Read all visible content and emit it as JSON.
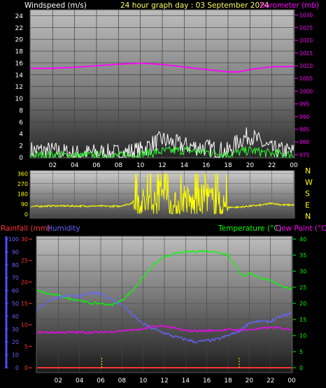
{
  "header": {
    "left_label": "Windspeed (m/s)",
    "title": "24 hour graph day : 03 September 2024",
    "right_label": "Barometer (mb)"
  },
  "colors": {
    "wind_axis": "#ffffff",
    "title": "#ffff66",
    "barometer": "#ff00ff",
    "wind_dir": "#ffff00",
    "rain_axis": "#ff3333",
    "humidity": "#6666ff",
    "temperature": "#00ff00",
    "dewpoint": "#ff00ff"
  },
  "panel3_labels": {
    "rainfall": "Rainfall (mm)",
    "humidity": "Humidity",
    "temperature": "Temperature (°C)",
    "dewpoint": "Dew Point (°C)"
  },
  "compass": [
    "N",
    "W",
    "S",
    "E",
    "N"
  ],
  "chart_data": [
    {
      "type": "line",
      "title": "24 hour graph day : 03 September 2024",
      "x_ticks": [
        "02",
        "04",
        "06",
        "08",
        "10",
        "12",
        "14",
        "16",
        "18",
        "20",
        "22",
        "00"
      ],
      "y_left": {
        "label": "Windspeed (m/s)",
        "ticks": [
          0,
          2,
          4,
          6,
          8,
          10,
          12,
          14,
          16,
          18,
          20,
          22,
          24
        ],
        "range": [
          0,
          25
        ]
      },
      "y_right": {
        "label": "Barometer (mb)",
        "ticks": [
          975,
          980,
          985,
          990,
          995,
          1000,
          1005,
          1010,
          1015,
          1020,
          1025,
          1030
        ],
        "range": [
          974,
          1032
        ]
      },
      "series": [
        {
          "name": "Barometer (mb)",
          "axis": "right",
          "x": [
            0,
            2,
            4,
            6,
            8,
            10,
            12,
            14,
            16,
            18,
            19,
            20,
            22,
            24
          ],
          "values": [
            1009,
            1009,
            1009.4,
            1010,
            1010.6,
            1011,
            1010.5,
            1009.5,
            1008.5,
            1007.6,
            1007.6,
            1008.5,
            1009.6,
            1009.7
          ]
        },
        {
          "axis": "left",
          "x": [
            0,
            2,
            4,
            6,
            8,
            10,
            11,
            12,
            13,
            14,
            16,
            18,
            19,
            20,
            21,
            22,
            24
          ],
          "values": [
            1.2,
            1.1,
            0.6,
            0.8,
            0.7,
            1.2,
            2.2,
            3,
            2.4,
            2,
            1.6,
            1,
            2.8,
            3.8,
            2.4,
            1.3,
            0.9
          ]
        },
        {
          "axis": "left",
          "x": [
            0,
            2,
            4,
            6,
            8,
            10,
            12,
            14,
            16,
            18,
            20,
            22,
            24
          ],
          "values": [
            0.3,
            0.4,
            0.2,
            0.3,
            0.2,
            0.5,
            1,
            1.2,
            0.9,
            0.5,
            1.2,
            0.6,
            0.4
          ]
        }
      ]
    },
    {
      "type": "scatter",
      "x_ticks": [
        "02",
        "04",
        "06",
        "08",
        "10",
        "12",
        "14",
        "16",
        "18",
        "20",
        "22",
        "00"
      ],
      "y_left": {
        "ticks": [
          0,
          90,
          180,
          270,
          360
        ],
        "range": [
          0,
          360
        ]
      },
      "series": [
        {
          "name": "Wind direction",
          "x": [
            0,
            2,
            4,
            6,
            8,
            9,
            10,
            11,
            12,
            13,
            14,
            15,
            16,
            17,
            18,
            19,
            20,
            21,
            22,
            23,
            24
          ],
          "values": [
            65,
            72,
            70,
            70,
            67,
            90,
            120,
            60,
            200,
            40,
            150,
            60,
            170,
            70,
            58,
            60,
            70,
            78,
            95,
            80,
            80
          ]
        }
      ]
    },
    {
      "type": "line",
      "x_ticks": [
        "02",
        "04",
        "06",
        "08",
        "10",
        "12",
        "14",
        "16",
        "18",
        "20",
        "22",
        "00"
      ],
      "y_left_rain": {
        "label": "Rainfall (mm)",
        "ticks": [
          0,
          5,
          10,
          15,
          20,
          25,
          30
        ],
        "range": [
          0,
          30
        ]
      },
      "y_left_humidity": {
        "label": "Humidity",
        "ticks": [
          0,
          10,
          20,
          30,
          40,
          50,
          60,
          70,
          80,
          90,
          100
        ],
        "range": [
          0,
          100
        ]
      },
      "y_right": {
        "label": "Temperature (°C)",
        "ticks": [
          0,
          5,
          10,
          15,
          20,
          25,
          30,
          35,
          40
        ],
        "range": [
          0,
          40
        ]
      },
      "series": [
        {
          "name": "Temperature (°C)",
          "axis": "right",
          "x": [
            0,
            1,
            2,
            3,
            4,
            5,
            6,
            7,
            8,
            9,
            10,
            11,
            12,
            13,
            14,
            15,
            16,
            17,
            18,
            19,
            19.5,
            20,
            21,
            22,
            23,
            24
          ],
          "values": [
            24,
            23,
            22.5,
            21.5,
            21,
            20,
            20,
            19.5,
            21,
            24,
            28,
            32,
            34.5,
            35.5,
            36,
            36.2,
            36.3,
            36,
            35.2,
            30,
            28.5,
            29.5,
            28,
            27,
            25.5,
            24.5
          ]
        },
        {
          "name": "Humidity",
          "axis": "left",
          "x": [
            0,
            1,
            2,
            3,
            4,
            5,
            6,
            7,
            8,
            9,
            10,
            11,
            12,
            13,
            14,
            15,
            16,
            17,
            18,
            19,
            20,
            21,
            22,
            23,
            24
          ],
          "values": [
            45,
            52,
            55,
            56,
            55,
            58,
            58,
            53,
            49,
            41,
            34,
            30,
            27,
            24,
            22,
            20,
            21,
            22,
            25,
            28,
            35,
            36,
            36,
            40,
            42
          ]
        },
        {
          "name": "Dew Point (°C)",
          "axis": "right",
          "x": [
            0,
            2,
            4,
            6,
            8,
            10,
            11,
            12,
            14,
            16,
            18,
            20,
            22,
            24
          ],
          "values": [
            11,
            11,
            11,
            11,
            11.5,
            12,
            12.8,
            13,
            11.5,
            11.5,
            11.8,
            11.8,
            12.5,
            12
          ]
        },
        {
          "name": "Rainfall (mm)",
          "axis": "left_rain",
          "x": [
            0,
            24
          ],
          "values": [
            0,
            0
          ]
        }
      ]
    }
  ]
}
